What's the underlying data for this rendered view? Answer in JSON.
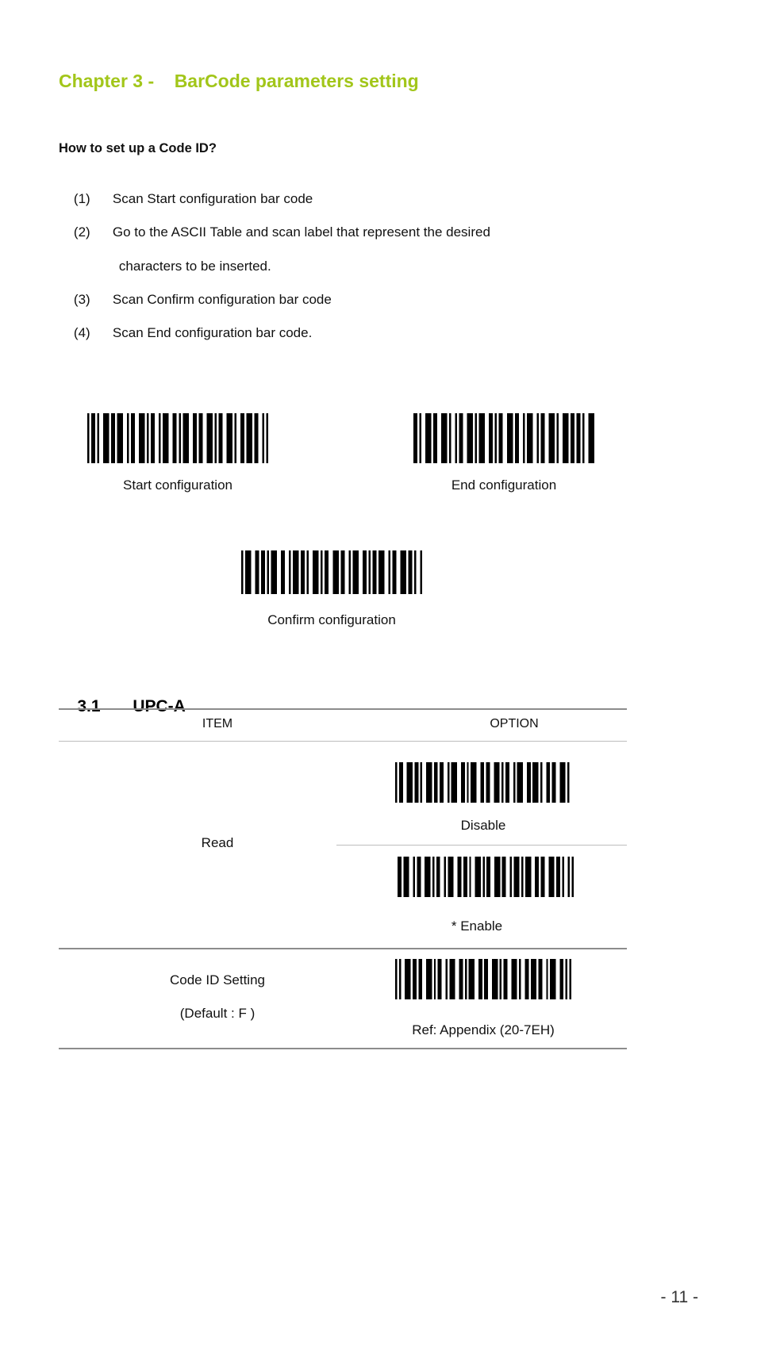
{
  "document": {
    "chapter_heading": "Chapter 3 -    BarCode parameters setting",
    "chapter_heading_color": "#A2C61A",
    "page_number": "- 11 -"
  },
  "intro": {
    "title": "How to set up a Code ID?",
    "steps": [
      {
        "num": "(1)",
        "text": "Scan Start configuration bar code"
      },
      {
        "num": "(2)",
        "text": "Go to the ASCII Table and scan label that represent the desired"
      },
      {
        "num": "",
        "text": "characters to be inserted."
      },
      {
        "num": "(3)",
        "text": "Scan Confirm configuration bar code"
      },
      {
        "num": "(4)",
        "text": "Scan End configuration bar code."
      }
    ]
  },
  "config_barcodes": [
    {
      "caption": "Start configuration",
      "pattern": "1011010011101101110010110011101011001011100110101110011011001110101100111010011011101100101"
    },
    {
      "caption": "End configuration",
      "pattern": "1101001110110011101001011001110101110011010110011101100101110010110011101001110110110100111"
    },
    {
      "caption": "Confirm configuration",
      "pattern": "1011100110110101110011001011101101001110101100111011001011100110101101110010110011101101001"
    }
  ],
  "table": {
    "section_number": "3.1",
    "section_title": "UPC-A",
    "headers": {
      "item": "ITEM",
      "option": "OPTION"
    },
    "rows": [
      {
        "item": "Read",
        "item_sub": "",
        "options": [
          {
            "label": "Disable",
            "pattern": "1011001110110100111011011001011100110101110011011001110101100101110011011101001101100111010"
          },
          {
            "label": "* Enable",
            "pattern": "1101110010110011101011001011100110110100111010110011101100101110101110011011001110110100101"
          }
        ]
      },
      {
        "item": "Code ID Setting",
        "item_sub": "(Default : F )",
        "options": [
          {
            "label": "Ref: Appendix (20-7EH)",
            "pattern": "1010011101101100111010110010111001101011100110110011101011001110100110111011001011100110101"
          }
        ]
      }
    ]
  }
}
